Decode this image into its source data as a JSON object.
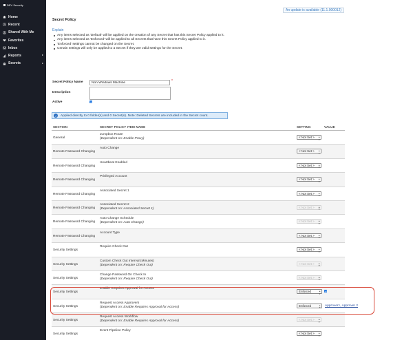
{
  "sidebar": {
    "brand": "DEV Security",
    "items": [
      {
        "label": "Home",
        "icon": "home-icon",
        "caret": false
      },
      {
        "label": "Recent",
        "icon": "clock-icon",
        "caret": false
      },
      {
        "label": "Shared With Me",
        "icon": "share-icon",
        "caret": false
      },
      {
        "label": "Favorites",
        "icon": "heart-icon",
        "caret": false
      },
      {
        "label": "Inbox",
        "icon": "inbox-icon",
        "caret": false
      },
      {
        "label": "Reports",
        "icon": "chart-icon",
        "caret": true
      },
      {
        "label": "Secrets",
        "icon": "lock-icon",
        "caret": true
      }
    ]
  },
  "header": {
    "update_link": "An update is available (11.1.000012)",
    "title": "Secret Policy"
  },
  "explain": {
    "link": "Explain",
    "bullets": [
      "Any items selected as 'Default' will be applied on the creation of any Secret that has this Secret Policy applied to it.",
      "Any items selected as 'Enforced' will be applied to all Secrets that have this Secret Policy applied to it.",
      "'Enforced' settings cannot be changed on the Secret.",
      "Certain settings will only be applied to a Secret if they are valid settings for the Secret."
    ]
  },
  "form": {
    "name_label": "Secret Policy Name",
    "name_value": "Non Windows Machine",
    "required_marker": "*",
    "description_label": "Description",
    "active_label": "Active"
  },
  "info": {
    "icon": "info-icon",
    "text": "Applied directly to 0 folder(s) and 0 Secret(s). Note: Deleted Secrets are included in the Secret count."
  },
  "table": {
    "headers": {
      "section": "SECTION",
      "item": "SECRET POLICY ITEM NAME",
      "setting": "SETTING",
      "value": "VALUE"
    },
    "rows": [
      {
        "section": "General",
        "item": "Jumpbox Route",
        "dep": "(Dependent on: Enable Proxy)",
        "setting": "< Not Set >",
        "disabled": false
      },
      {
        "section": "Remote Password Changing",
        "item": "Auto Change",
        "dep": "",
        "setting": "< Not Set >",
        "disabled": false
      },
      {
        "section": "Remote Password Changing",
        "item": "Heartbeat Enabled",
        "dep": "",
        "setting": "< Not Set >",
        "disabled": false
      },
      {
        "section": "Remote Password Changing",
        "item": "Privileged Account",
        "dep": "",
        "setting": "< Not Set >",
        "disabled": false
      },
      {
        "section": "Remote Password Changing",
        "item": "Associated Secret 1",
        "dep": "",
        "setting": "< Not Set >",
        "disabled": false
      },
      {
        "section": "Remote Password Changing",
        "item": "Associated Secret 2",
        "dep": "(Dependent on: Associated Secret 1)",
        "setting": "< Not Set >",
        "disabled": true
      },
      {
        "section": "Remote Password Changing",
        "item": "Auto Change Schedule",
        "dep": "(Dependent on: Auto Change)",
        "setting": "< Not Set >",
        "disabled": true
      },
      {
        "section": "Remote Password Changing",
        "item": "Account Type",
        "dep": "",
        "setting": "< Not Set >",
        "disabled": false
      },
      {
        "section": "Security Settings",
        "item": "Require Check Out",
        "dep": "",
        "setting": "< Not Set >",
        "disabled": false
      },
      {
        "section": "Security Settings",
        "item": "Custom Check Out Interval (Minutes)",
        "dep": "(Dependent on: Require Check Out)",
        "setting": "< Not Set >",
        "disabled": true
      },
      {
        "section": "Security Settings",
        "item": "Change Password On Check In",
        "dep": "(Dependent on: Require Check Out)",
        "setting": "< Not Set >",
        "disabled": true
      },
      {
        "section": "Security Settings",
        "item": "Enable Requires Approval for Access",
        "dep": "",
        "setting": "Enforced",
        "disabled": false,
        "value_check": true
      },
      {
        "section": "Security Settings",
        "item": "Request Access Approvers",
        "dep": "(Dependent on: Enable Requires Approval for Access)",
        "setting": "Enforced",
        "disabled": false,
        "value_text": "Approver1, Approver 2"
      },
      {
        "section": "Security Settings",
        "item": "Request Access Workflow",
        "dep": "(Dependent on: Enable Requires Approval for Access)",
        "setting": "< Not Set >",
        "disabled": true
      },
      {
        "section": "Security Settings",
        "item": "Event Pipeline Policy",
        "dep": "",
        "setting": "< Not Set >",
        "disabled": false
      }
    ]
  },
  "colors": {
    "sidebar_bg": "#1a1d26",
    "link": "#3a7bbf",
    "info_bg": "#dcebf9",
    "checkbox": "#2a7de1",
    "highlight": "#d94a3b"
  }
}
